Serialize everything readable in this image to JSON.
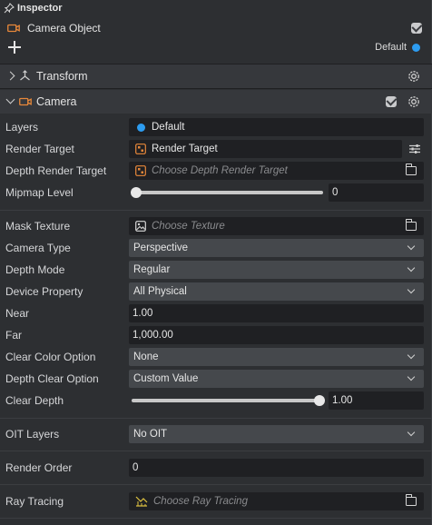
{
  "header": {
    "title": "Inspector"
  },
  "object": {
    "name": "Camera Object",
    "layer_label": "Default"
  },
  "sections": {
    "transform": {
      "title": "Transform"
    },
    "camera": {
      "title": "Camera"
    }
  },
  "props": {
    "layers": {
      "label": "Layers",
      "value": "Default"
    },
    "render_target": {
      "label": "Render Target",
      "value": "Render Target"
    },
    "depth_render_target": {
      "label": "Depth Render Target",
      "placeholder": "Choose Depth Render Target"
    },
    "mipmap_level": {
      "label": "Mipmap Level",
      "value": "0",
      "fraction": 0.0
    },
    "mask_texture": {
      "label": "Mask Texture",
      "placeholder": "Choose Texture"
    },
    "camera_type": {
      "label": "Camera Type",
      "value": "Perspective"
    },
    "depth_mode": {
      "label": "Depth Mode",
      "value": "Regular"
    },
    "device_property": {
      "label": "Device Property",
      "value": "All Physical"
    },
    "near": {
      "label": "Near",
      "value": "1.00"
    },
    "far": {
      "label": "Far",
      "value": "1,000.00"
    },
    "clear_color_option": {
      "label": "Clear Color Option",
      "value": "None"
    },
    "depth_clear_option": {
      "label": "Depth Clear Option",
      "value": "Custom Value"
    },
    "clear_depth": {
      "label": "Clear Depth",
      "value": "1.00",
      "fraction": 1.0
    },
    "oit_layers": {
      "label": "OIT Layers",
      "value": "No OIT"
    },
    "render_order": {
      "label": "Render Order",
      "value": "0"
    },
    "ray_tracing": {
      "label": "Ray Tracing",
      "placeholder": "Choose Ray Tracing"
    }
  },
  "colors": {
    "accent_blue": "#2d9cf0",
    "camera_orange": "#e8883a",
    "raytrace_yellow": "#e0c341"
  }
}
